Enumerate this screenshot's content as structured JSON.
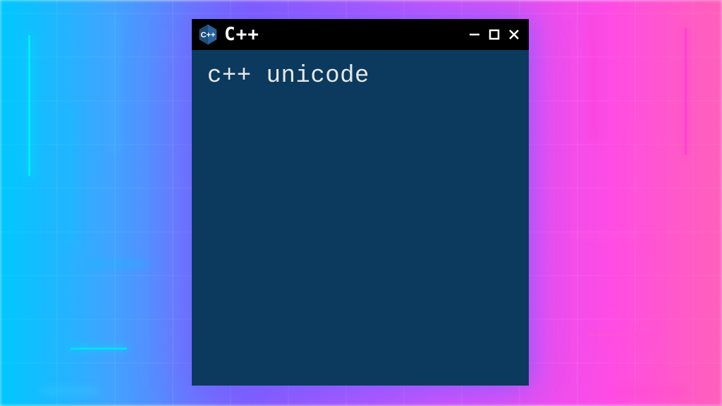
{
  "window": {
    "title": "C++",
    "icon_name": "cpp-logo"
  },
  "terminal": {
    "content": "c++ unicode"
  },
  "colors": {
    "terminal_bg": "#0b3a5e",
    "titlebar_bg": "#000000",
    "text": "#e8e8e8"
  }
}
